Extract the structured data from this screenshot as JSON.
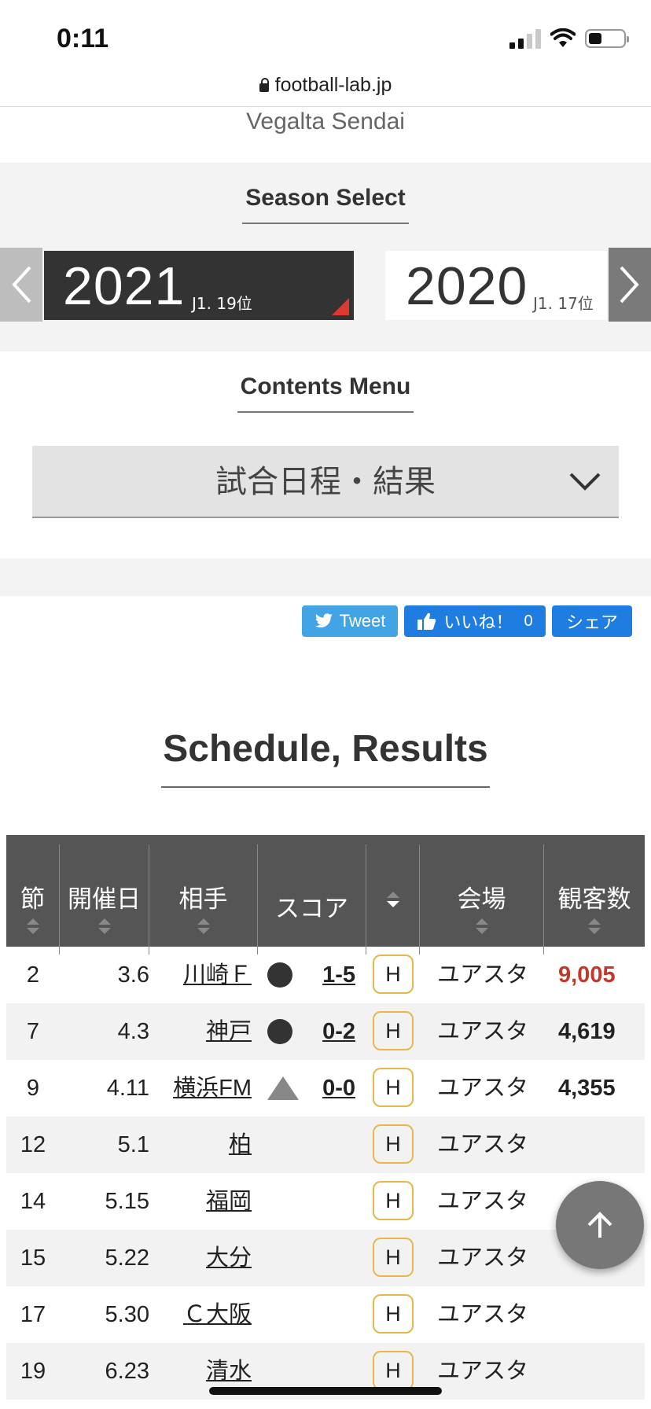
{
  "status_bar": {
    "time": "0:11"
  },
  "browser": {
    "url": "football-lab.jp"
  },
  "team": {
    "name_en": "Vegalta Sendai"
  },
  "season_select": {
    "title": "Season Select",
    "current": {
      "year": "2021",
      "rank": "J1. 19位"
    },
    "other": {
      "year": "2020",
      "rank": "J1. 17位"
    }
  },
  "contents_menu": {
    "title": "Contents Menu",
    "selected": "試合日程・結果"
  },
  "share": {
    "tweet": "Tweet",
    "like": "いいね！",
    "like_count": "0",
    "share": "シェア"
  },
  "schedule": {
    "title": "Schedule, Results",
    "columns": [
      "節",
      "開催日",
      "相手",
      "スコア",
      "",
      "会場",
      "観客数"
    ],
    "rows": [
      {
        "sec": "2",
        "date": "3.6",
        "opponent": "川崎Ｆ",
        "mark": "loss",
        "score": "1-5",
        "ha": "H",
        "venue": "ユアスタ",
        "attendance": "9,005",
        "att_color": "#c0392b"
      },
      {
        "sec": "7",
        "date": "4.3",
        "opponent": "神戸",
        "mark": "loss",
        "score": "0-2",
        "ha": "H",
        "venue": "ユアスタ",
        "attendance": "4,619",
        "att_color": "#222222"
      },
      {
        "sec": "9",
        "date": "4.11",
        "opponent": "横浜FM",
        "mark": "draw",
        "score": "0-0",
        "ha": "H",
        "venue": "ユアスタ",
        "attendance": "4,355",
        "att_color": "#222222"
      },
      {
        "sec": "12",
        "date": "5.1",
        "opponent": "柏",
        "mark": "",
        "score": "",
        "ha": "H",
        "venue": "ユアスタ",
        "attendance": "",
        "att_color": "#222222"
      },
      {
        "sec": "14",
        "date": "5.15",
        "opponent": "福岡",
        "mark": "",
        "score": "",
        "ha": "H",
        "venue": "ユアスタ",
        "attendance": "",
        "att_color": "#222222"
      },
      {
        "sec": "15",
        "date": "5.22",
        "opponent": "大分",
        "mark": "",
        "score": "",
        "ha": "H",
        "venue": "ユアスタ",
        "attendance": "",
        "att_color": "#222222"
      },
      {
        "sec": "17",
        "date": "5.30",
        "opponent": "Ｃ大阪",
        "mark": "",
        "score": "",
        "ha": "H",
        "venue": "ユアスタ",
        "attendance": "",
        "att_color": "#222222"
      },
      {
        "sec": "19",
        "date": "6.23",
        "opponent": "清水",
        "mark": "",
        "score": "",
        "ha": "H",
        "venue": "ユアスタ",
        "attendance": "",
        "att_color": "#222222"
      }
    ]
  },
  "icons": {
    "lock": "lock-icon",
    "prev": "chevron-left-icon",
    "next": "chevron-right-icon",
    "dropdown": "chevron-down-icon",
    "scroll_top": "arrow-up-icon"
  },
  "colors": {
    "header_bg": "#555555",
    "accent_red": "#c0392b",
    "home_border": "#e8b64a",
    "twitter": "#42a4e4",
    "facebook": "#1f7ce0"
  }
}
